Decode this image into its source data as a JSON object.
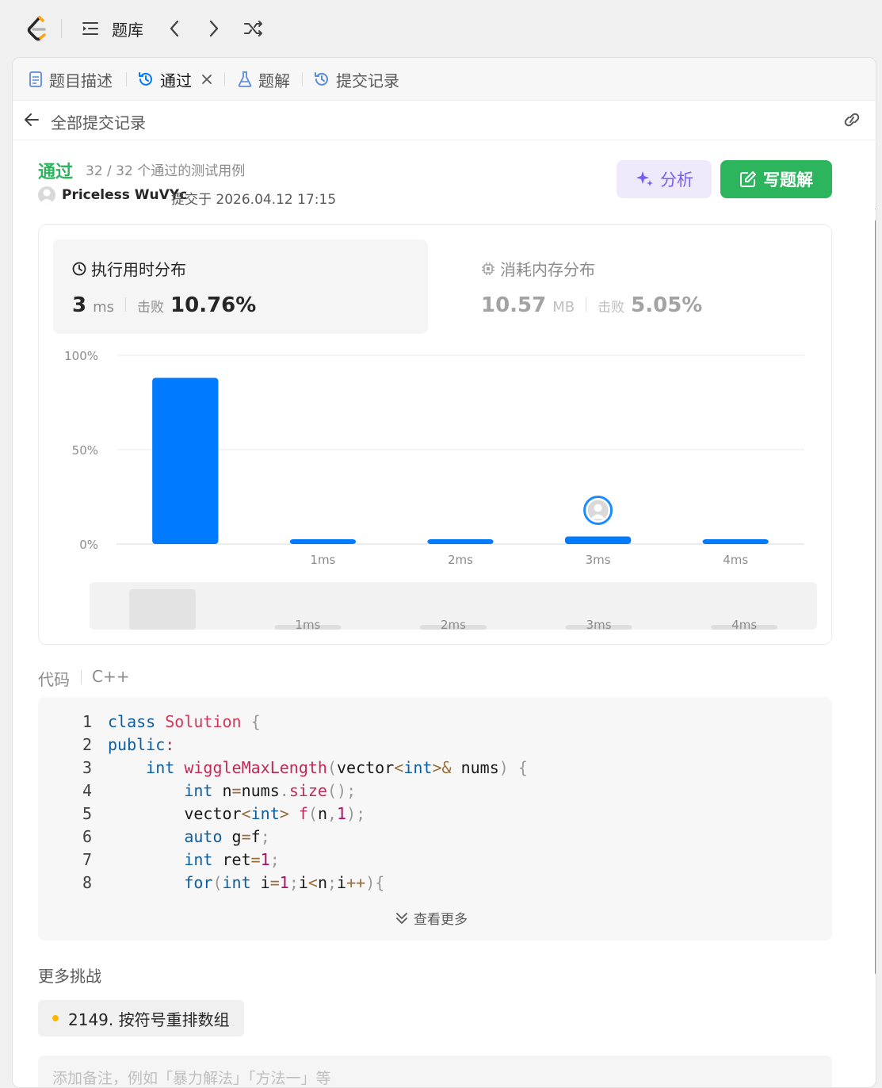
{
  "topbar": {
    "title": "题库"
  },
  "tabs": [
    {
      "label": "题目描述"
    },
    {
      "label": "通过"
    },
    {
      "label": "题解"
    },
    {
      "label": "提交记录"
    }
  ],
  "subheader": {
    "back_label": "全部提交记录"
  },
  "submission": {
    "status": "通过",
    "cases": "32 / 32 个通过的测试用例",
    "author": "Priceless WuVYc",
    "submitted": "提交于 2026.04.12 17:15",
    "analyze_label": "分析",
    "write_label": "写题解"
  },
  "runtime": {
    "title": "执行用时分布",
    "value": "3",
    "unit": "ms",
    "beat_label": "击败",
    "beat_value": "10.76%"
  },
  "memory": {
    "title": "消耗内存分布",
    "value": "10.57",
    "unit": "MB",
    "beat_label": "击败",
    "beat_value": "5.05%"
  },
  "chart_data": {
    "type": "bar",
    "categories": [
      "",
      "1ms",
      "2ms",
      "3ms",
      "4ms"
    ],
    "values": [
      88,
      2.5,
      2.5,
      4,
      2.5
    ],
    "ylim": [
      0,
      100
    ],
    "yticks": [
      "100%",
      "50%",
      "0%"
    ],
    "ytick_values": [
      100,
      50,
      0
    ],
    "highlight_category": "3ms",
    "bar_color": "#007aff",
    "grid": true,
    "navigator_labels": [
      "1ms",
      "2ms",
      "3ms",
      "4ms"
    ]
  },
  "code": {
    "label": "代码",
    "language": "C++",
    "lines": [
      {
        "n": "1"
      },
      {
        "n": "2"
      },
      {
        "n": "3"
      },
      {
        "n": "4"
      },
      {
        "n": "5"
      },
      {
        "n": "6"
      },
      {
        "n": "7"
      },
      {
        "n": "8"
      }
    ],
    "show_more": "查看更多"
  },
  "more": {
    "title": "更多挑战",
    "challenge": "2149. 按符号重排数组",
    "challenge_dot_color": "#ffb800"
  },
  "note": {
    "placeholder": "添加备注，例如「暴力解法」「方法一」等"
  },
  "colors": {
    "accepted": "#2db55d",
    "bar": "#007aff",
    "write_button": "#2cb55d",
    "analyze_button": "#7b5cf0"
  }
}
